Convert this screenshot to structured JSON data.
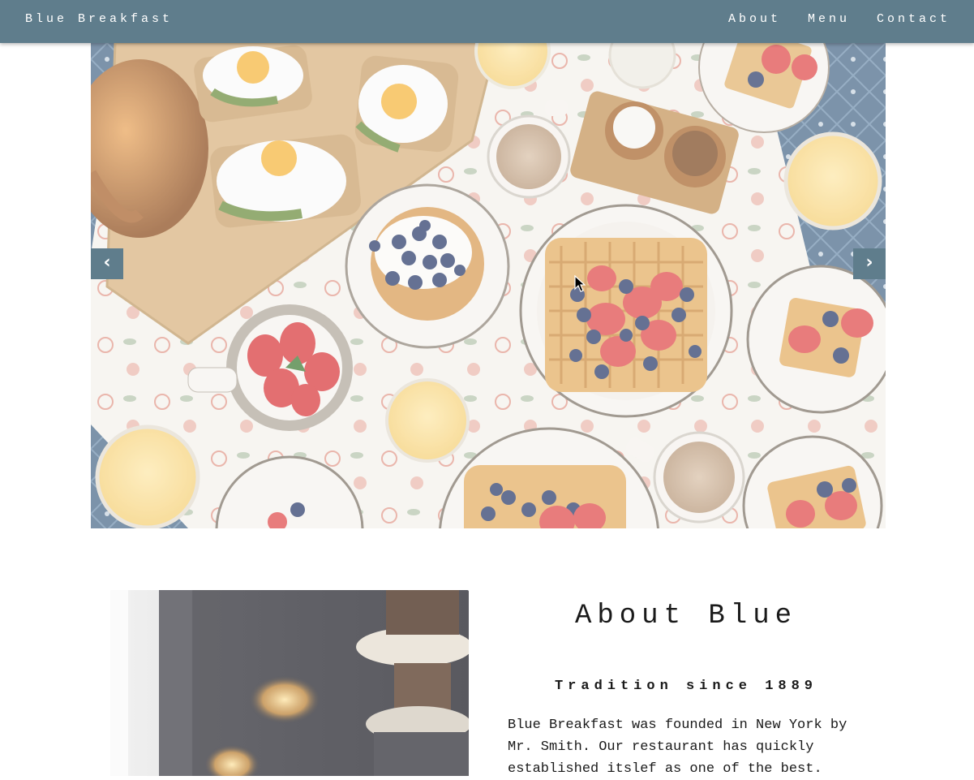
{
  "navbar": {
    "brand": "Blue Breakfast",
    "links": [
      {
        "label": "About"
      },
      {
        "label": "Menu"
      },
      {
        "label": "Contact"
      }
    ],
    "background": "#5f7d8c"
  },
  "carousel": {
    "prev_icon": "‹",
    "next_icon": "›",
    "image": "breakfast-table-photo"
  },
  "about": {
    "title": "About Blue",
    "subtitle": "Tradition since 1889",
    "text": "Blue Breakfast was founded in New York by Mr. Smith. Our restaurant has quickly established itslef as one of the best.",
    "image": "bakery-interior-photo"
  },
  "colors": {
    "accent": "#5f7d8c",
    "text": "#1a1a1a"
  }
}
